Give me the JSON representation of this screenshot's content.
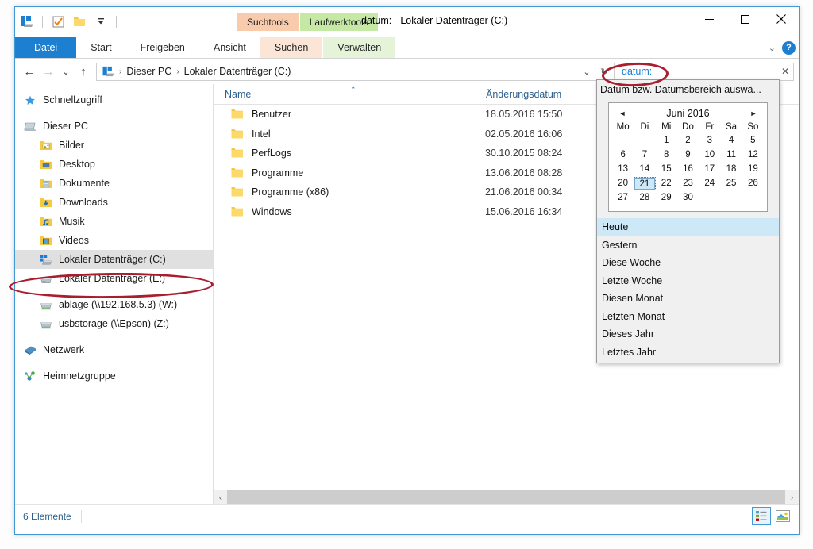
{
  "window": {
    "title": "datum: - Lokaler Datenträger (C:)",
    "minimize_label": "—",
    "maximize_label": "☐",
    "close_label": "✕"
  },
  "quick_access": {
    "items": [
      {
        "name": "explorer-drive-icon",
        "label": ""
      },
      {
        "name": "properties-icon",
        "label": ""
      },
      {
        "name": "new-folder-icon",
        "label": ""
      },
      {
        "name": "customize-dropdown-icon",
        "label": "▾"
      }
    ]
  },
  "contextual_tabs": [
    {
      "label": "Suchtools",
      "color": "#f8cbad"
    },
    {
      "label": "Laufwerktools",
      "color": "#c5e8a5"
    }
  ],
  "ribbon": {
    "tabs": [
      {
        "label": "Datei",
        "state": "active-file"
      },
      {
        "label": "Start",
        "state": "normal"
      },
      {
        "label": "Freigeben",
        "state": "normal"
      },
      {
        "label": "Ansicht",
        "state": "normal"
      },
      {
        "label": "Suchen",
        "state": "ctx-search"
      },
      {
        "label": "Verwalten",
        "state": "ctx-drive"
      }
    ],
    "collapse_icon": "⌄",
    "help_label": "?"
  },
  "navigation": {
    "back_icon": "←",
    "forward_icon": "→",
    "history_icon": "⌄",
    "up_icon": "↑",
    "breadcrumb": {
      "root_icon": "drive-icon",
      "items": [
        "Dieser PC",
        "Lokaler Datenträger (C:)"
      ],
      "separator": "›"
    },
    "address_dropdown_icon": "⌄",
    "refresh_icon": "↻"
  },
  "search": {
    "value": "datum:",
    "clear_icon": "✕"
  },
  "sidebar": {
    "items": [
      {
        "label": "Schnellzugriff",
        "icon": "star-icon",
        "indent": 0,
        "selected": false,
        "gap_before": false
      },
      {
        "label": "Dieser PC",
        "icon": "computer-icon",
        "indent": 0,
        "selected": false,
        "gap_before": true
      },
      {
        "label": "Bilder",
        "icon": "pictures-folder-icon",
        "indent": 1,
        "selected": false,
        "gap_before": false
      },
      {
        "label": "Desktop",
        "icon": "desktop-folder-icon",
        "indent": 1,
        "selected": false,
        "gap_before": false
      },
      {
        "label": "Dokumente",
        "icon": "documents-folder-icon",
        "indent": 1,
        "selected": false,
        "gap_before": false
      },
      {
        "label": "Downloads",
        "icon": "downloads-folder-icon",
        "indent": 1,
        "selected": false,
        "gap_before": false
      },
      {
        "label": "Musik",
        "icon": "music-folder-icon",
        "indent": 1,
        "selected": false,
        "gap_before": false
      },
      {
        "label": "Videos",
        "icon": "videos-folder-icon",
        "indent": 1,
        "selected": false,
        "gap_before": false
      },
      {
        "label": "Lokaler Datenträger (C:)",
        "icon": "system-drive-icon",
        "indent": 1,
        "selected": true,
        "gap_before": false
      },
      {
        "label": "Lokaler Datenträger (E:)",
        "icon": "drive-icon",
        "indent": 1,
        "selected": false,
        "gap_before": false
      },
      {
        "label": "ablage (\\\\192.168.5.3) (W:)",
        "icon": "network-drive-icon",
        "indent": 1,
        "selected": false,
        "gap_before": true
      },
      {
        "label": "usbstorage (\\\\Epson) (Z:)",
        "icon": "network-drive-icon",
        "indent": 1,
        "selected": false,
        "gap_before": false
      },
      {
        "label": "Netzwerk",
        "icon": "network-icon",
        "indent": 0,
        "selected": false,
        "gap_before": true
      },
      {
        "label": "Heimnetzgruppe",
        "icon": "homegroup-icon",
        "indent": 0,
        "selected": false,
        "gap_before": true
      }
    ]
  },
  "filelist": {
    "columns": [
      {
        "label": "Name",
        "sorted": true,
        "sort_icon": "⌃"
      },
      {
        "label": "Änderungsdatum",
        "sorted": false
      }
    ],
    "rows": [
      {
        "name": "Benutzer",
        "date": "18.05.2016 15:50"
      },
      {
        "name": "Intel",
        "date": "02.05.2016 16:06"
      },
      {
        "name": "PerfLogs",
        "date": "30.10.2015 08:24"
      },
      {
        "name": "Programme",
        "date": "13.06.2016 08:28"
      },
      {
        "name": "Programme (x86)",
        "date": "21.06.2016 00:34"
      },
      {
        "name": "Windows",
        "date": "15.06.2016 16:34"
      }
    ]
  },
  "scrollbar": {
    "left_arrow": "‹",
    "right_arrow": "›"
  },
  "statusbar": {
    "item_count": "6 Elemente",
    "view_buttons": [
      {
        "name": "details-view-button",
        "active": true
      },
      {
        "name": "large-icons-view-button",
        "active": false
      }
    ]
  },
  "date_dropdown": {
    "title": "Datum bzw. Datumsbereich auswä...",
    "calendar": {
      "prev_icon": "◄",
      "next_icon": "►",
      "month_label": "Juni 2016",
      "weekdays": [
        "Mo",
        "Di",
        "Mi",
        "Do",
        "Fr",
        "Sa",
        "So"
      ],
      "leading_blanks": 2,
      "days": [
        1,
        2,
        3,
        4,
        5,
        6,
        7,
        8,
        9,
        10,
        11,
        12,
        13,
        14,
        15,
        16,
        17,
        18,
        19,
        20,
        21,
        22,
        23,
        24,
        25,
        26,
        27,
        28,
        29,
        30
      ],
      "selected_day": 21
    },
    "presets": [
      {
        "label": "Heute",
        "highlighted": true
      },
      {
        "label": "Gestern",
        "highlighted": false
      },
      {
        "label": "Diese Woche",
        "highlighted": false
      },
      {
        "label": "Letzte Woche",
        "highlighted": false
      },
      {
        "label": "Diesen Monat",
        "highlighted": false
      },
      {
        "label": "Letzten Monat",
        "highlighted": false
      },
      {
        "label": "Dieses Jahr",
        "highlighted": false
      },
      {
        "label": "Letztes Jahr",
        "highlighted": false
      }
    ]
  },
  "annotations": {
    "color": "#a81e2e",
    "shapes": [
      "search-field-ellipse",
      "drive-c-ellipse"
    ]
  }
}
